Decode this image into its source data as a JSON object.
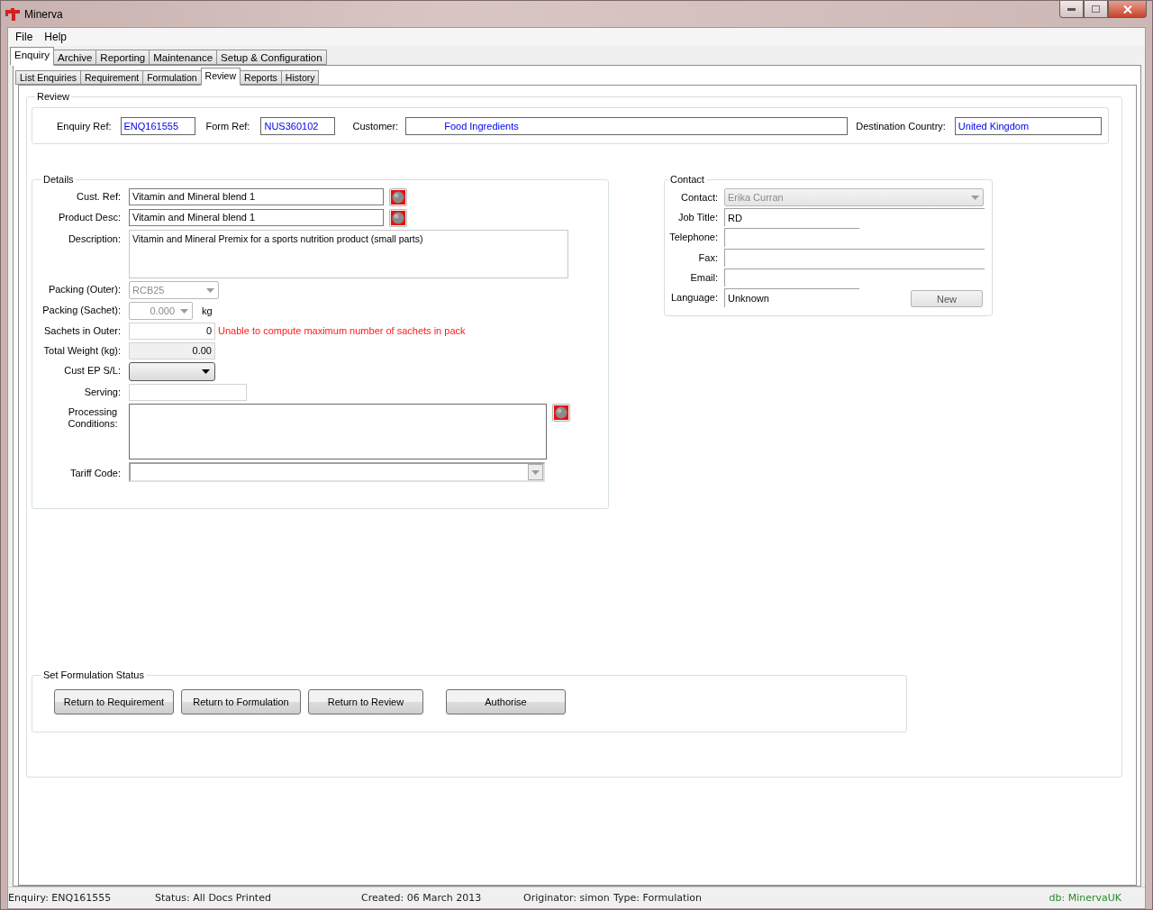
{
  "window": {
    "title": "Minerva"
  },
  "menu": [
    "File",
    "Help"
  ],
  "tabs": [
    {
      "label": "Enquiry",
      "selected": true
    },
    {
      "label": "Archive",
      "selected": false
    },
    {
      "label": "Reporting",
      "selected": false
    },
    {
      "label": "Maintenance",
      "selected": false
    },
    {
      "label": "Setup & Configuration",
      "selected": false
    }
  ],
  "subtabs": [
    {
      "label": "List Enquiries",
      "selected": false
    },
    {
      "label": "Requirement",
      "selected": false
    },
    {
      "label": "Formulation",
      "selected": false
    },
    {
      "label": "Review",
      "selected": true
    },
    {
      "label": "Reports",
      "selected": false
    },
    {
      "label": "History",
      "selected": false
    }
  ],
  "review": {
    "title": "Review",
    "refs": [
      {
        "label": "Enquiry Ref:",
        "value": "ENQ161555"
      },
      {
        "label": "Form Ref:",
        "value": "NUS360102"
      },
      {
        "label": "Customer:",
        "value": "Food Ingredients"
      },
      {
        "label": "Destination Country:",
        "value": "United Kingdom"
      }
    ]
  },
  "details": {
    "title": "Details",
    "fields": [
      {
        "kind": "text",
        "label": "Cust. Ref:",
        "value": "Vitamin and Mineral blend 1",
        "tool": true
      },
      {
        "kind": "text",
        "label": "Product Desc:",
        "value": "Vitamin and Mineral blend 1",
        "tool": true
      },
      {
        "kind": "memo",
        "label": "Description:",
        "value": "Vitamin and Mineral Premix for a sports nutrition product (small parts)",
        "tool": false
      },
      {
        "kind": "select",
        "label": "Packing (Outer):",
        "value": "RCB25"
      },
      {
        "kind": "select",
        "label": "Packing (Sachet):",
        "value": "0.000",
        "unit": "kg"
      },
      {
        "kind": "number",
        "label": "Sachets in Outer:",
        "value": "0",
        "message": "Unable to compute maximum number of sachets in pack"
      },
      {
        "kind": "readonly",
        "label": "Total Weight (kg):",
        "value": "0.00"
      },
      {
        "kind": "dropbutton",
        "label": "Cust EP S/L:"
      },
      {
        "kind": "short",
        "label": "Serving:"
      },
      {
        "kind": "memo",
        "label": "Processing Conditions:",
        "tool": true
      },
      {
        "kind": "combo",
        "label": "Tariff Code:"
      }
    ]
  },
  "contact": {
    "title": "Contact",
    "fields": [
      {
        "kind": "select",
        "label": "Contact:",
        "value": "Erika Curran"
      },
      {
        "kind": "wide",
        "label": "Job Title:",
        "value": "RD"
      },
      {
        "kind": "short",
        "label": "Telephone:"
      },
      {
        "kind": "wide",
        "label": "Fax:"
      },
      {
        "kind": "wide",
        "label": "Email:"
      },
      {
        "kind": "short",
        "label": "Language:",
        "value": "Unknown"
      }
    ],
    "button": "New"
  },
  "status_group": {
    "title": "Set Formulation Status",
    "buttons": [
      "Return to Requirement",
      "Return to Formulation",
      "Return to Review",
      "Authorise"
    ]
  },
  "status_bar": {
    "items": [
      "Enquiry: ENQ161555",
      "Status: All Docs Printed",
      "Created: 06 March 2013",
      "Originator: simon",
      "Type: Formulation"
    ],
    "db": "db: MinervaUK"
  }
}
